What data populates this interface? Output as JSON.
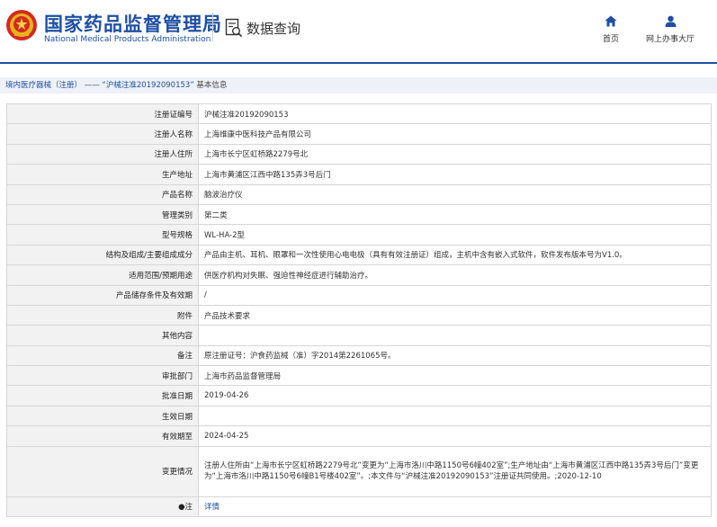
{
  "header": {
    "brand_cn": "国家药品监督管理局",
    "brand_en": "National Medical Products Administration",
    "query_label": "数据查询",
    "nav": {
      "home": "首页",
      "hall": "网上办事大厅"
    },
    "logo_icon": "nmpa-emblem-icon",
    "accent_color": "#1e4fa3"
  },
  "breadcrumb": {
    "part1": "境内医疗器械（注册）",
    "sep": " —— ",
    "part2": "“沪械注准20192090153”",
    "part3": "基本信息"
  },
  "details": {
    "reg_no": {
      "label": "注册证编号",
      "value": "沪械注准20192090153"
    },
    "registrant": {
      "label": "注册人名称",
      "value": "上海维康中医科技产品有限公司"
    },
    "registrant_addr": {
      "label": "注册人住所",
      "value": "上海市长宁区虹桥路2279号北"
    },
    "prod_addr": {
      "label": "生产地址",
      "value": "上海市黄浦区江西中路135弄3号后门"
    },
    "product_name": {
      "label": "产品名称",
      "value": "脑波治疗仪"
    },
    "category": {
      "label": "管理类别",
      "value": "第二类"
    },
    "model": {
      "label": "型号规格",
      "value": "WL-HA-2型"
    },
    "structure": {
      "label": "结构及组成/主要组成成分",
      "value": "产品由主机、耳机、眼罩和一次性使用心电电极（具有有效注册证）组成，主机中含有嵌入式软件，软件发布版本号为V1.0。"
    },
    "scope": {
      "label": "适用范围/预期用途",
      "value": "供医疗机构对失眠、强迫性神经症进行辅助治疗。"
    },
    "storage": {
      "label": "产品储存条件及有效期",
      "value": "/"
    },
    "attachment": {
      "label": "附件",
      "value": "产品技术要求"
    },
    "other": {
      "label": "其他内容",
      "value": ""
    },
    "remark": {
      "label": "备注",
      "value": "原注册证号：沪食药监械（准）字2014第2261065号。"
    },
    "approver": {
      "label": "审批部门",
      "value": "上海市药品监督管理局"
    },
    "approval_date": {
      "label": "批准日期",
      "value": "2019-04-26"
    },
    "effective_date": {
      "label": "生效日期",
      "value": ""
    },
    "expiry": {
      "label": "有效期至",
      "value": "2024-04-25"
    },
    "changes": {
      "label": "变更情况",
      "value": "注册人住所由“上海市长宁区虹桥路2279号北”变更为“上海市洛川中路1150号6幢402室”;生产地址由“上海市黄浦区江西中路135弄3号后门”变更为“上海市洛川中路1150号6幢B1号楼402室”。;本文件与“沪械注准20192090153”注册证共同使用。;2020-12-10"
    },
    "note": {
      "label": "注",
      "value": "详情",
      "icon": "bullet-icon"
    }
  }
}
